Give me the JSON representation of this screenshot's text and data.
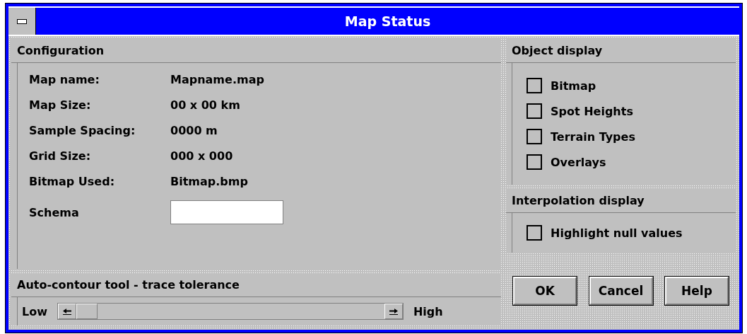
{
  "window": {
    "title": "Map Status"
  },
  "configuration": {
    "title": "Configuration",
    "fields": [
      {
        "label": "Map name:",
        "value": "Mapname.map"
      },
      {
        "label": "Map Size:",
        "value": "00 x 00 km"
      },
      {
        "label": "Sample Spacing:",
        "value": "0000 m"
      },
      {
        "label": "Grid Size:",
        "value": "000 x 000"
      },
      {
        "label": "Bitmap Used:",
        "value": "Bitmap.bmp"
      }
    ],
    "schema": {
      "label": "Schema"
    }
  },
  "auto_contour": {
    "title": "Auto-contour tool - trace tolerance",
    "low_label": "Low",
    "high_label": "High"
  },
  "object_display": {
    "title": "Object display",
    "options": [
      {
        "label": "Bitmap",
        "checked": false
      },
      {
        "label": "Spot Heights",
        "checked": false
      },
      {
        "label": "Terrain Types",
        "checked": false
      },
      {
        "label": "Overlays",
        "checked": false
      }
    ]
  },
  "interpolation_display": {
    "title": "Interpolation display",
    "options": [
      {
        "label": "Highlight null values",
        "checked": false
      }
    ]
  },
  "buttons": [
    "OK",
    "Cancel",
    "Help"
  ]
}
